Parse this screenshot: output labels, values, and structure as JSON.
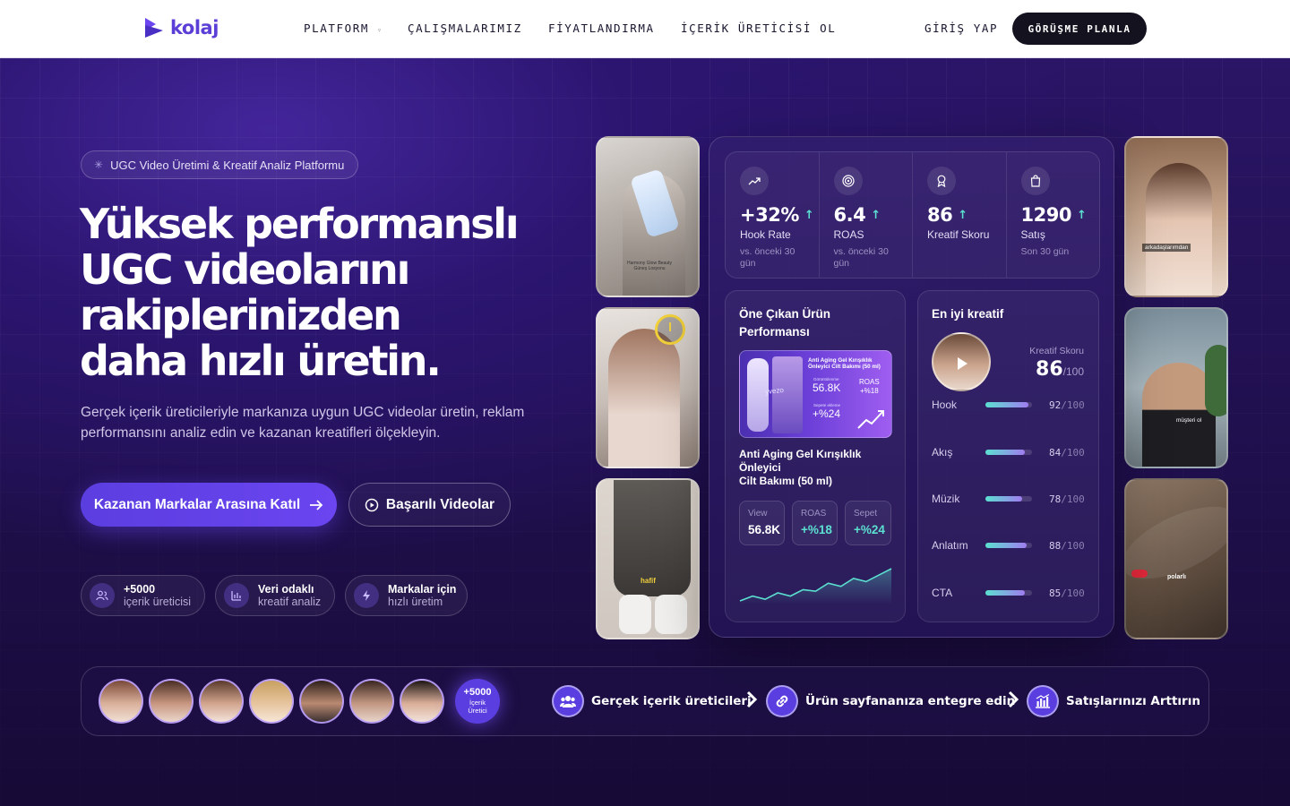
{
  "nav": {
    "logo": "kolaj",
    "links": [
      "PLATFORM",
      "ÇALIŞMALARIMIZ",
      "FİYATLANDIRMA",
      "İÇERİK ÜRETİCİSİ OL"
    ],
    "login": "GİRİŞ YAP",
    "cta": "GÖRÜŞME PLANLA"
  },
  "hero": {
    "badge": "UGC Video Üretimi & Kreatif Analiz Platformu",
    "headline": [
      "Yüksek performanslı",
      "UGC videolarını",
      "rakiplerinizden",
      "daha hızlı üretin."
    ],
    "subtitle": "Gerçek içerik üreticileriyle markanıza uygun UGC videolar üretin, reklam performansını analiz edin ve kazanan kreatifleri ölçekleyin.",
    "primary_button": "Kazanan Markalar Arasına Katıl",
    "secondary_button": "Başarılı Videolar",
    "features": [
      {
        "title": "+5000",
        "desc": "içerik üreticisi",
        "icon": "users-icon"
      },
      {
        "title": "Veri odaklı",
        "desc": "kreatif analiz",
        "icon": "bar-chart-icon"
      },
      {
        "title": "Markalar için",
        "desc": "hızlı üretim",
        "icon": "bolt-icon"
      }
    ]
  },
  "videos": {
    "captions": [
      "Harmony Glow Beauty\nGüneş Losyonu",
      "",
      "",
      "arkadaşlarımdan",
      "müşteri ol",
      "polarlı"
    ],
    "sock_label": "hafif"
  },
  "dashboard": {
    "stats": [
      {
        "value": "+32%",
        "label": "Hook Rate",
        "note": "vs. önceki 30 gün",
        "icon": "trend-up-icon"
      },
      {
        "value": "6.4",
        "label": "ROAS",
        "note": "vs. önceki 30 gün",
        "icon": "target-icon"
      },
      {
        "value": "86",
        "label": "Kreatif Skoru",
        "note": "",
        "icon": "award-icon"
      },
      {
        "value": "1290",
        "label": "Satış",
        "note": "Son 30 gün",
        "icon": "bag-icon"
      }
    ],
    "product": {
      "title": "Öne Çıkan Ürün Performansı",
      "banner_title": "Anti Aging Gel Kırışıklık Önleyici Cilt Bakımı (50 ml)",
      "banner_views_label": "Görüntülenme",
      "banner_views": "56.8K",
      "banner_roas_label": "ROAS",
      "banner_roas": "+%18",
      "banner_cart_label": "Sepete ekleme",
      "banner_cart": "+%24",
      "brand": "yvezo",
      "name_line1": "Anti Aging Gel Kırışıklık Önleyici",
      "name_line2": "Cilt Bakımı (50 ml)",
      "metrics": [
        {
          "label": "View",
          "value": "56.8K"
        },
        {
          "label": "ROAS",
          "value": "+%18"
        },
        {
          "label": "Sepet",
          "value": "+%24"
        }
      ],
      "trend": [
        2,
        5,
        3,
        7,
        5,
        9,
        8,
        13,
        11,
        16,
        14,
        18,
        22
      ]
    },
    "best": {
      "title": "En iyi kreatif",
      "score_label": "Kreatif Skoru",
      "score": "86",
      "score_max": "/100",
      "metrics": [
        {
          "name": "Hook",
          "value": 92,
          "max": "/100"
        },
        {
          "name": "Akış",
          "value": 84,
          "max": "/100"
        },
        {
          "name": "Müzik",
          "value": 78,
          "max": "/100"
        },
        {
          "name": "Anlatım",
          "value": 88,
          "max": "/100"
        },
        {
          "name": "CTA",
          "value": 85,
          "max": "/100"
        }
      ]
    }
  },
  "band": {
    "count": "+5000",
    "count_label": "İçerik Üretici",
    "steps": [
      "Gerçek içerik üreticileri",
      "Ürün sayfananıza entegre edin",
      "Satışlarınızı Arttırın"
    ]
  },
  "colors": {
    "accent": "#5b3ee0",
    "teal": "#5be0d0",
    "bg": "#1a0d3a"
  }
}
